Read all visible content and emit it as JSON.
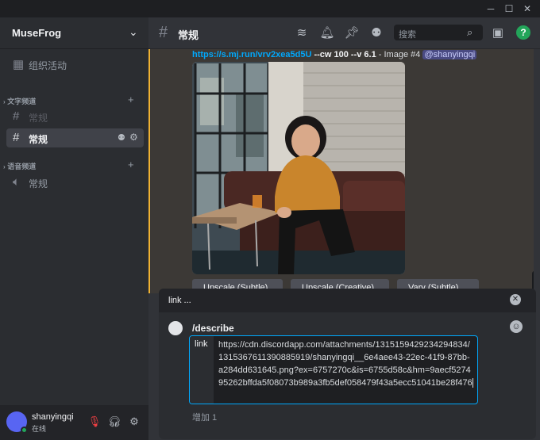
{
  "titlebar": {
    "minimize": "─",
    "maximize": "☐",
    "close": "✕"
  },
  "sidebar": {
    "guild_name": "MuseFrog",
    "events_label": "组织活动",
    "text_category": "文字频道",
    "text_channels": [
      {
        "label": "常规",
        "active": false
      },
      {
        "label": "常规",
        "active": true
      }
    ],
    "voice_category": "语音频道",
    "voice_channels": [
      {
        "label": "常规"
      }
    ]
  },
  "user": {
    "name": "shanyingqi",
    "status": "在线",
    "status_color": "#23a55a"
  },
  "header": {
    "channel_name": "常规",
    "search_placeholder": "搜索",
    "icons": [
      "threads-icon",
      "bell-icon",
      "pin-icon",
      "members-icon",
      "inbox-icon",
      "help-icon"
    ]
  },
  "message": {
    "prompt_link": "https://s.mj.run/vrv2xea5d5U",
    "prompt_params": "--cw 100 --v 6.1",
    "prompt_meta": "- Image #4",
    "mention": "@shanyingqi",
    "buttons": [
      "Upscale (Subtle)",
      "Upscale (Creative)",
      "Vary (Subtle)"
    ],
    "accent": "#f0b232"
  },
  "popup": {
    "title": "link ...",
    "command": "/describe",
    "option_name": "link",
    "option_value": "https://cdn.discordapp.com/attachments/1315159429234294834/1315367611390885919/shanyingqi__6e4aee43-22ec-41f9-87bb-a284dd631645.png?ex=6757270c&is=6755d58c&hm=9aecf527495262bffda5f08073b989a3fb5def058479f43a5ecc51041be28f476",
    "add_more": "增加 1"
  }
}
